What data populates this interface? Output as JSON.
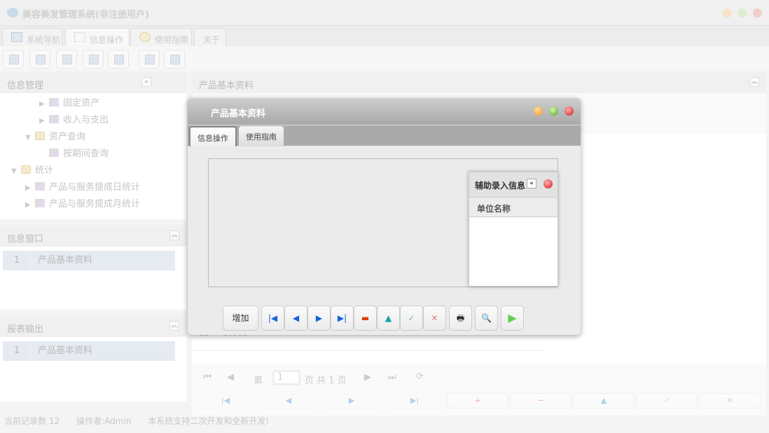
{
  "app": {
    "title": "美容美发管理系统(非注册用户)"
  },
  "tabs": [
    {
      "label": "系统导航",
      "icon": "monitor-icon"
    },
    {
      "label": "信息操作",
      "icon": "grid-icon"
    },
    {
      "label": "使用指南",
      "icon": "clock-icon"
    },
    {
      "label": "关于"
    }
  ],
  "toolbar": [
    "search-doc-icon",
    "list-icon",
    "document-icon",
    "user-screen-icon",
    "screen-globe-icon",
    "window-add-icon",
    "window-icon"
  ],
  "left": {
    "nav_title": "信息管理",
    "tree": [
      {
        "label": "固定资产",
        "level": 2,
        "type": "leaf-collapsed"
      },
      {
        "label": "收入与支出",
        "level": 2,
        "type": "leaf-collapsed"
      },
      {
        "label": "资产查询",
        "level": 1,
        "type": "folder-open"
      },
      {
        "label": "按期间查询",
        "level": 2,
        "type": "leaf"
      },
      {
        "label": "统计",
        "level": 0,
        "type": "folder-open"
      },
      {
        "label": "产品与服务提成日统计",
        "level": 1,
        "type": "leaf-collapsed"
      },
      {
        "label": "产品与服务提成月统计",
        "level": 1,
        "type": "leaf-collapsed"
      }
    ],
    "window_title": "信息窗口",
    "window_rows": [
      {
        "num": "1",
        "label": "产品基本资料"
      }
    ],
    "report_title": "报表输出",
    "report_rows": [
      {
        "num": "1",
        "label": "产品基本资料"
      }
    ]
  },
  "main": {
    "title": "产品基本资料",
    "row": {
      "num": "12",
      "code": "10012"
    },
    "pager": {
      "page_prefix": "第",
      "page": "1",
      "page_suffix": "页 共 1 页"
    },
    "buttons": [
      "|◀",
      "◀",
      "▶",
      "▶|",
      "+",
      "−",
      "▲",
      "✓",
      "✕"
    ]
  },
  "modal": {
    "title": "产品基本资料",
    "tabs": [
      "信息操作",
      "使用指南"
    ],
    "aux": {
      "title": "辅助录入信息",
      "column": "单位名称"
    },
    "add_label": "增加",
    "buttons": [
      {
        "g": "⏮",
        "n": "first-icon"
      },
      {
        "g": "◀",
        "n": "prev-icon"
      },
      {
        "g": "▶",
        "n": "next-icon"
      },
      {
        "g": "⏭",
        "n": "last-icon"
      },
      {
        "g": "▬",
        "n": "delete-icon"
      },
      {
        "g": "▲",
        "n": "up-icon"
      },
      {
        "g": "✓",
        "n": "check-icon"
      },
      {
        "g": "✕",
        "n": "cancel-icon"
      },
      {
        "g": "🖶",
        "n": "print-icon"
      },
      {
        "g": "🔍",
        "n": "preview-icon"
      },
      {
        "g": "▶",
        "n": "run-icon"
      }
    ]
  },
  "status": {
    "records": "当前记录数 12",
    "operator": "操作者:Admin",
    "note": "本系统支持二次开发和全新开发!"
  },
  "colors": {
    "accent_blue": "#1565d8",
    "close_red": "#e03030",
    "min_orange": "#f0a030",
    "max_green": "#60b030"
  }
}
